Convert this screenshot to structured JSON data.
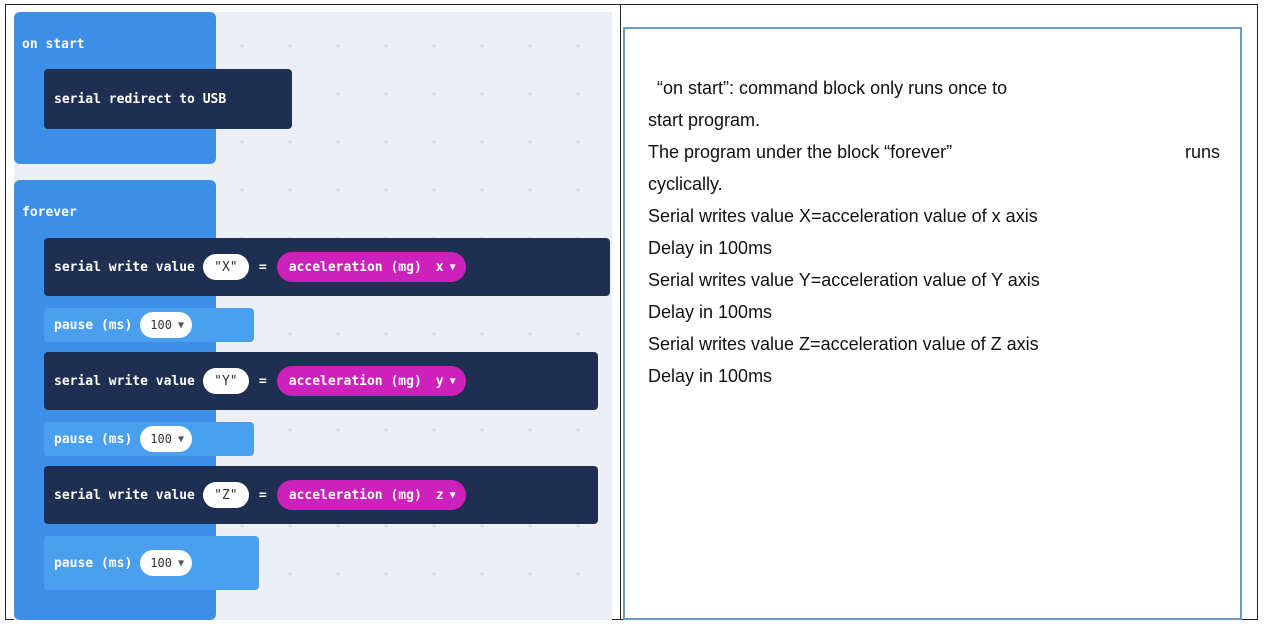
{
  "workspace": {
    "on_start": {
      "label": "on start",
      "block": "serial redirect to USB"
    },
    "forever": {
      "label": "forever",
      "blocks": [
        {
          "type": "serial_write_value",
          "text": "serial write value",
          "name": "\"X\"",
          "eq": "=",
          "sensor": "acceleration (mg)",
          "axis": "x"
        },
        {
          "type": "pause",
          "text": "pause (ms)",
          "value": "100"
        },
        {
          "type": "serial_write_value",
          "text": "serial write value",
          "name": "\"Y\"",
          "eq": "=",
          "sensor": "acceleration (mg)",
          "axis": "y"
        },
        {
          "type": "pause",
          "text": "pause (ms)",
          "value": "100"
        },
        {
          "type": "serial_write_value",
          "text": "serial write value",
          "name": "\"Z\"",
          "eq": "=",
          "sensor": "acceleration (mg)",
          "axis": "z"
        },
        {
          "type": "pause",
          "text": "pause (ms)",
          "value": "100"
        }
      ]
    },
    "dropdown_icon": "caret-down-icon"
  },
  "description": {
    "line1_a": "“on start”: command block only runs once to",
    "line2": "start program.",
    "line3_a": "The program under the block “forever”",
    "line3_b": "runs",
    "line4": "cyclically.",
    "line5": "Serial writes value X=acceleration value of x axis",
    "line6": "Delay in 100ms",
    "line7": "Serial writes value Y=acceleration value of Y axis",
    "line8": "Delay in 100ms",
    "line9": "Serial writes value Z=acceleration value of Z axis",
    "line10": "Delay in 100ms"
  },
  "colors": {
    "hat_blue": "#3d8ee6",
    "serial_navy": "#1e2f52",
    "accel_magenta": "#cc22bb",
    "border_blue": "#6d9ac5"
  }
}
